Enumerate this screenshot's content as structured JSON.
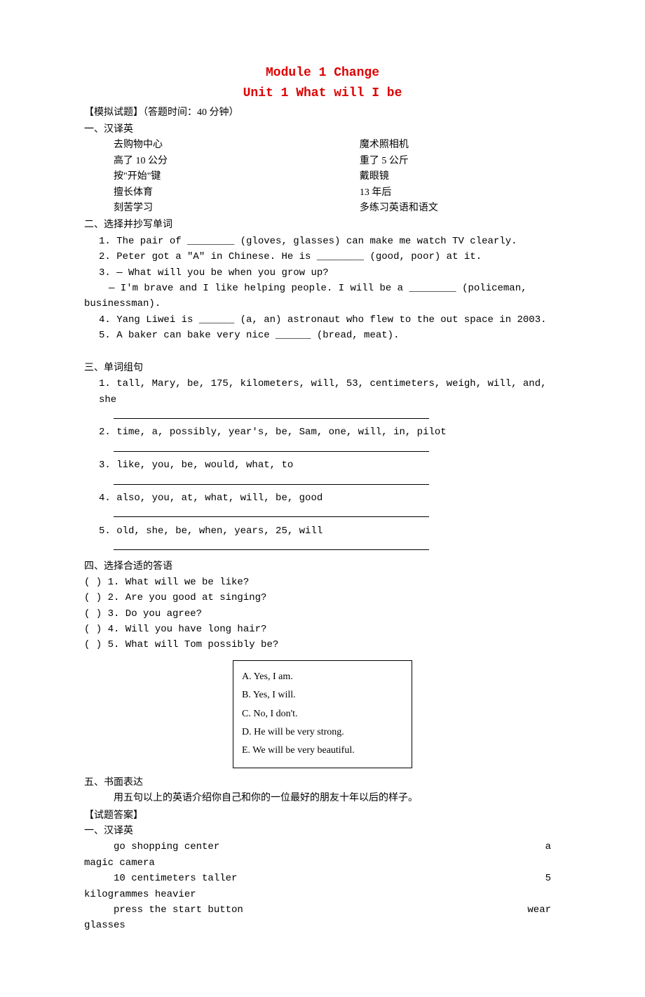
{
  "title": "Module 1 Change",
  "subtitle": "Unit 1 What will I be",
  "test_header": "【模拟试题】（答题时间：40 分钟）",
  "s1": {
    "heading": "一、汉译英",
    "rows": [
      {
        "l": "去购物中心",
        "r": "魔术照相机"
      },
      {
        "l": "高了 10 公分",
        "r": "重了 5 公斤"
      },
      {
        "l": "按\"开始\"键",
        "r": "戴眼镜"
      },
      {
        "l": "擅长体育",
        "r": "13 年后"
      },
      {
        "l": "刻苦学习",
        "r": "多练习英语和语文"
      }
    ]
  },
  "s2": {
    "heading": "二、选择并抄写单词",
    "items": [
      "1. The pair of ________ (gloves, glasses) can make me watch TV clearly.",
      "2. Peter got a \"A\" in Chinese. He is ________ (good, poor) at it.",
      "3. — What will you be when you grow up?",
      "   — I'm brave and I like helping people. I will be a ________ (policeman, businessman).",
      "4. Yang Liwei is ______ (a, an) astronaut who flew to the out space in 2003.",
      "5. A baker can bake very nice ______ (bread, meat)."
    ]
  },
  "s3": {
    "heading": "三、单词组句",
    "items": [
      "1. tall, Mary, be, 175, kilometers, will, 53, centimeters, weigh, will, and, she",
      "2. time, a, possibly, year's, be, Sam, one, will, in, pilot",
      "3. like, you, be, would, what, to",
      "4. also, you, at, what, will, be, good",
      "5. old, she, be, when, years, 25, will"
    ]
  },
  "s4": {
    "heading": "四、选择合适的答语",
    "items": [
      "(        ) 1. What will we be like?",
      "(        ) 2. Are you good at singing?",
      "(        ) 3. Do you agree?",
      "(        ) 4. Will you have long hair?",
      "(        ) 5. What will Tom possibly be?"
    ],
    "options": [
      "A. Yes, I am.",
      "B. Yes, I will.",
      "C. No, I don't.",
      "D. He will be very strong.",
      "E. We will be very beautiful."
    ]
  },
  "s5": {
    "heading": "五、书面表达",
    "prompt": "用五句以上的英语介绍你自己和你的一位最好的朋友十年以后的样子。"
  },
  "answers": {
    "heading": "【试题答案】",
    "s1head": "一、汉译英",
    "rows": [
      {
        "l": "go shopping center",
        "r": "a"
      },
      {
        "l": "magic camera"
      },
      {
        "l": "10 centimeters taller",
        "r": "5"
      },
      {
        "l": "kilogrammes heavier"
      },
      {
        "l": "press the start button",
        "r": "wear"
      },
      {
        "l": "glasses"
      }
    ]
  }
}
